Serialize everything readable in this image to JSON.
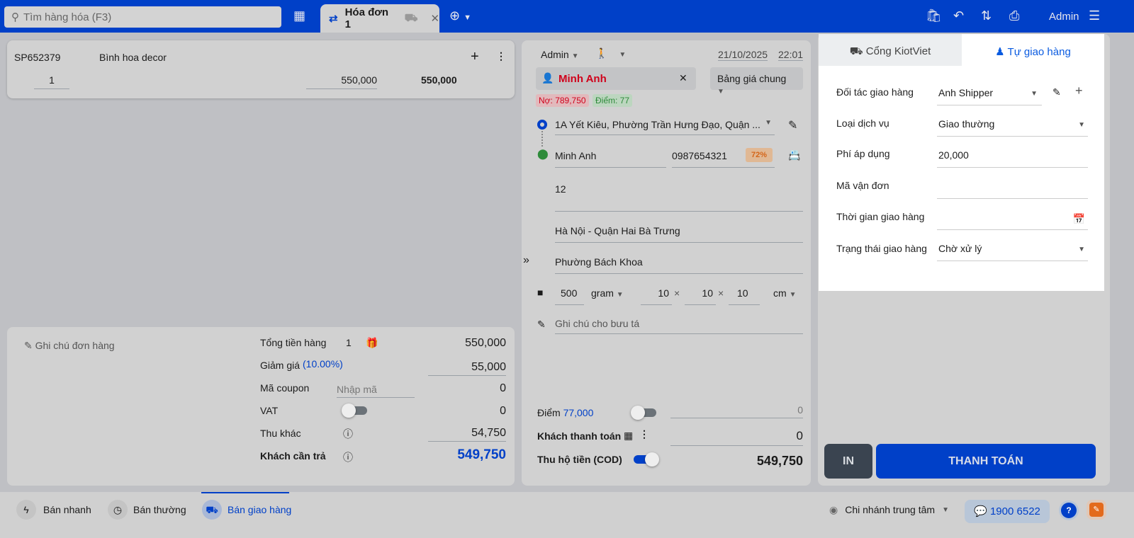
{
  "header": {
    "search_placeholder": "Tìm hàng hóa (F3)",
    "tab_label": "Hóa đơn 1",
    "user": "Admin"
  },
  "cart": {
    "items": [
      {
        "code": "SP652379",
        "name": "Bình hoa decor",
        "qty": "1",
        "price": "550,000",
        "total": "550,000"
      }
    ]
  },
  "summary": {
    "note_label": "Ghi chú đơn hàng",
    "subtotal_label": "Tổng tiền hàng",
    "subtotal_qty": "1",
    "subtotal": "550,000",
    "discount_label": "Giảm giá",
    "discount_pct": "(10.00%)",
    "discount": "55,000",
    "coupon_label": "Mã coupon",
    "coupon_placeholder": "Nhập mã",
    "coupon": "0",
    "vat_label": "VAT",
    "vat": "0",
    "other_label": "Thu khác",
    "other": "54,750",
    "due_label": "Khách cần trả",
    "due": "549,750"
  },
  "order": {
    "seller": "Admin",
    "date": "21/10/2025",
    "time": "22:01",
    "customer": "Minh Anh",
    "price_list": "Bảng giá chung",
    "debt": "Nợ: 789,750",
    "points": "Điểm: 77",
    "pickup_address": "1A Yết Kiêu, Phường Trần Hưng Đạo, Quận ...",
    "receiver_name": "Minh Anh",
    "receiver_phone": "0987654321",
    "success_rate": "72%",
    "address_line": "12",
    "city_district": "Hà Nội - Quận Hai Bà Trưng",
    "ward": "Phường Bách Khoa",
    "weight": "500",
    "weight_unit": "gram",
    "length": "10",
    "width": "10",
    "height": "10",
    "dim_unit": "cm",
    "x": "×",
    "courier_note_placeholder": "Ghi chú cho bưu tá",
    "points_label": "Điểm",
    "points_value": "77,000",
    "points_used": "0",
    "paid_label": "Khách thanh toán",
    "paid": "0",
    "cod_label": "Thu hộ tiền (COD)",
    "cod": "549,750"
  },
  "delivery": {
    "tabs": [
      "Cổng KiotViet",
      "Tự giao hàng"
    ],
    "partner_label": "Đối tác giao hàng",
    "partner": "Anh Shipper",
    "service_label": "Loại dịch vụ",
    "service": "Giao thường",
    "fee_label": "Phí áp dụng",
    "fee": "20,000",
    "tracking_label": "Mã vận đơn",
    "time_label": "Thời gian giao hàng",
    "status_label": "Trạng thái giao hàng",
    "status": "Chờ xử lý"
  },
  "actions": {
    "print": "IN",
    "pay": "THANH TOÁN"
  },
  "footer": {
    "modes": [
      "Bán nhanh",
      "Bán thường",
      "Bán giao hàng"
    ],
    "branch": "Chi nhánh trung tâm",
    "hotline": "1900 6522"
  },
  "colors": {
    "primary": "#0040c8",
    "debt": "#d0021b",
    "points": "#2e8b3a"
  }
}
